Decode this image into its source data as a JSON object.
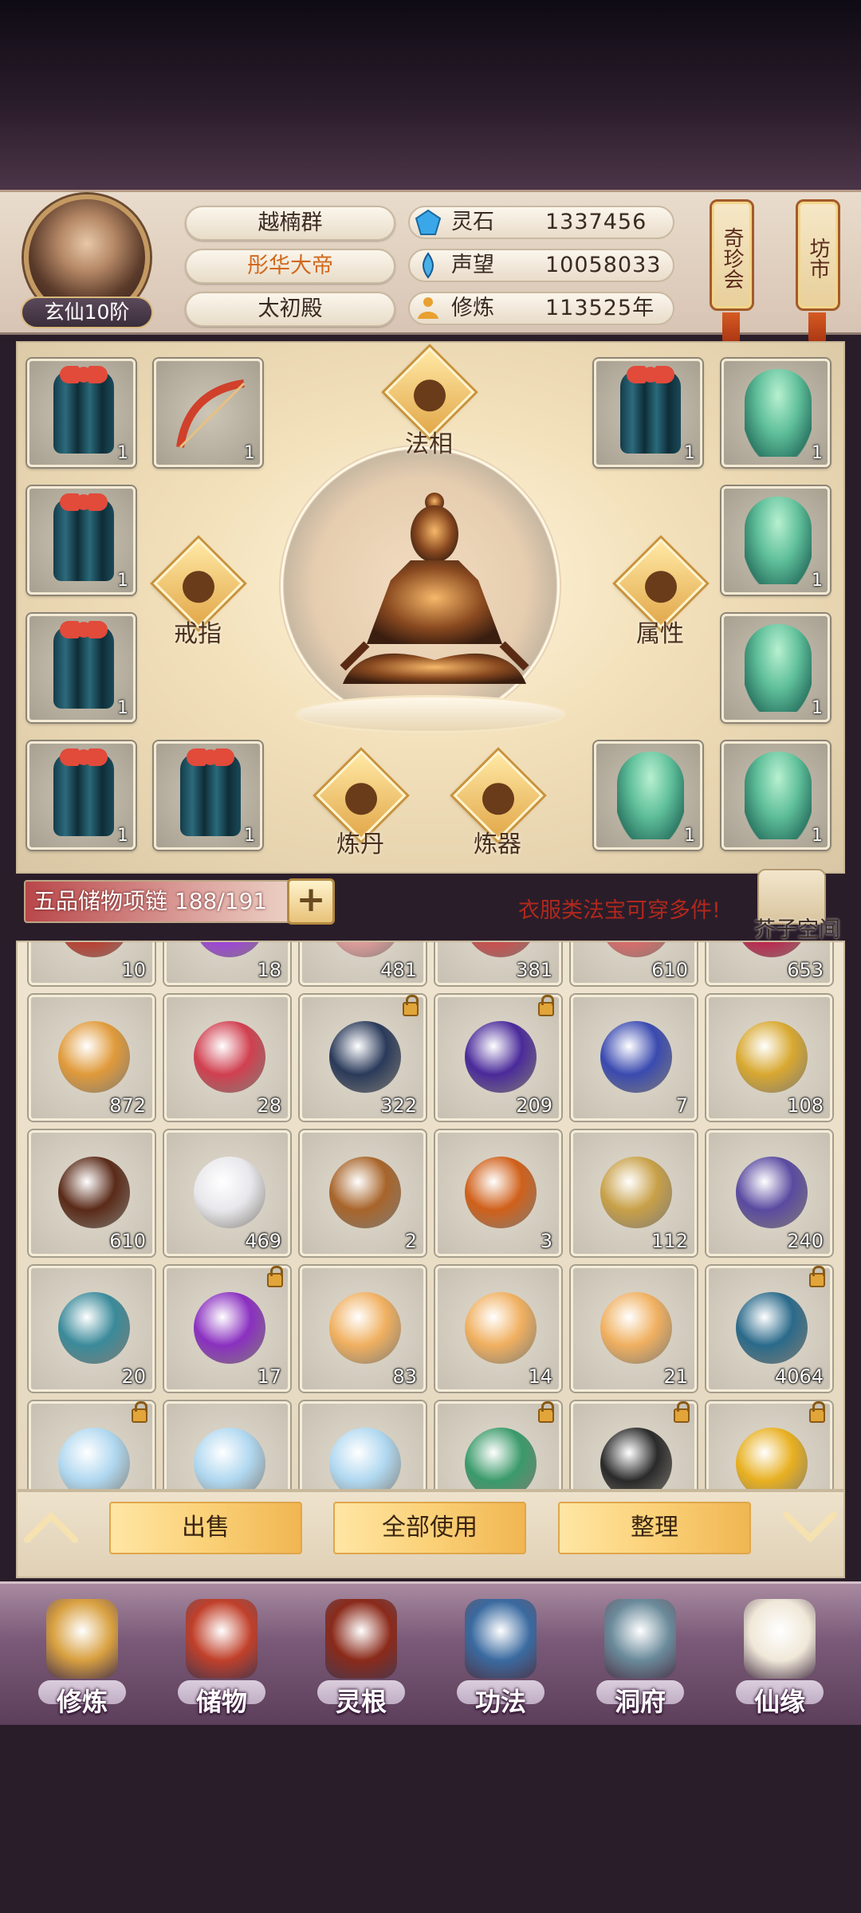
{
  "profile": {
    "name": "越楠群",
    "title": "彤华大帝",
    "sect": "太初殿",
    "rank": "玄仙10阶"
  },
  "resources": [
    {
      "label": "灵石",
      "value": "1337456",
      "icon": "spirit-stone-icon"
    },
    {
      "label": "声望",
      "value": "10058033",
      "icon": "prestige-icon"
    },
    {
      "label": "修炼",
      "value": "113525年",
      "icon": "cultivation-icon"
    }
  ],
  "banners": {
    "treasure_hall": "奇珍会",
    "market": "坊市"
  },
  "equipment": {
    "dharma_label": "法相",
    "ring_label": "戒指",
    "attr_label": "属性",
    "alchemy_label": "炼丹",
    "forge_label": "炼器",
    "slots": [
      {
        "item": "robe",
        "count": "1"
      },
      {
        "item": "bow",
        "count": "1"
      },
      {
        "item": "robe",
        "count": "1"
      },
      {
        "item": "jade-spirit",
        "count": "1"
      },
      {
        "item": "robe",
        "count": "1"
      },
      {
        "item": "jade-spirit",
        "count": "1"
      },
      {
        "item": "robe",
        "count": "1"
      },
      {
        "item": "jade-spirit",
        "count": "1"
      },
      {
        "item": "robe",
        "count": "1"
      },
      {
        "item": "robe",
        "count": "1"
      },
      {
        "item": "jade-spirit",
        "count": "1"
      },
      {
        "item": "jade-spirit",
        "count": "1"
      }
    ]
  },
  "storage": {
    "label": "五品储物项链 188/191",
    "expand": "+",
    "hint": "衣服类法宝可穿多件!",
    "space_label": "芥子空间"
  },
  "inventory": [
    {
      "count": "10",
      "color": "#c0392b",
      "locked": false
    },
    {
      "count": "18",
      "color": "#a040e0",
      "locked": false
    },
    {
      "count": "481",
      "color": "#e8a0a0",
      "locked": false
    },
    {
      "count": "381",
      "color": "#d04a4a",
      "locked": false
    },
    {
      "count": "610",
      "color": "#e06a6a",
      "locked": false
    },
    {
      "count": "653",
      "color": "#c0204a",
      "locked": false
    },
    {
      "count": "872",
      "color": "#e09a3a",
      "locked": false
    },
    {
      "count": "28",
      "color": "#d04050",
      "locked": false
    },
    {
      "count": "322",
      "color": "#2a3a5a",
      "locked": true
    },
    {
      "count": "209",
      "color": "#4a2a9a",
      "locked": true
    },
    {
      "count": "7",
      "color": "#3a4ab0",
      "locked": false
    },
    {
      "count": "108",
      "color": "#d8a830",
      "locked": false
    },
    {
      "count": "610",
      "color": "#5a2a18",
      "locked": false
    },
    {
      "count": "469",
      "color": "#e8e8ec",
      "locked": false
    },
    {
      "count": "2",
      "color": "#a8642a",
      "locked": false
    },
    {
      "count": "3",
      "color": "#d0601a",
      "locked": false
    },
    {
      "count": "112",
      "color": "#c8a048",
      "locked": false
    },
    {
      "count": "240",
      "color": "#5a4aa0",
      "locked": false
    },
    {
      "count": "20",
      "color": "#3a8a9a",
      "locked": false
    },
    {
      "count": "17",
      "color": "#8a30c0",
      "locked": true
    },
    {
      "count": "83",
      "color": "#f0b060",
      "locked": false
    },
    {
      "count": "14",
      "color": "#f0b060",
      "locked": false
    },
    {
      "count": "21",
      "color": "#f0b060",
      "locked": false
    },
    {
      "count": "4064",
      "color": "#2a6a8a",
      "locked": true
    },
    {
      "count": "",
      "color": "#b0d8f0",
      "locked": true
    },
    {
      "count": "",
      "color": "#b0d8f0",
      "locked": false
    },
    {
      "count": "",
      "color": "#b0d8f0",
      "locked": false
    },
    {
      "count": "",
      "color": "#3a9a6a",
      "locked": true
    },
    {
      "count": "",
      "color": "#2a2a2a",
      "locked": true
    },
    {
      "count": "",
      "color": "#e8b020",
      "locked": true
    }
  ],
  "actions": {
    "sell": "出售",
    "use_all": "全部使用",
    "sort": "整理"
  },
  "nav": [
    {
      "label": "修炼",
      "color": "#d8a040"
    },
    {
      "label": "储物",
      "color": "#c0402a"
    },
    {
      "label": "灵根",
      "color": "#8a2a1a"
    },
    {
      "label": "功法",
      "color": "#3a6aa0"
    },
    {
      "label": "洞府",
      "color": "#6a8a9a"
    },
    {
      "label": "仙缘",
      "color": "#f0e8d8"
    }
  ]
}
